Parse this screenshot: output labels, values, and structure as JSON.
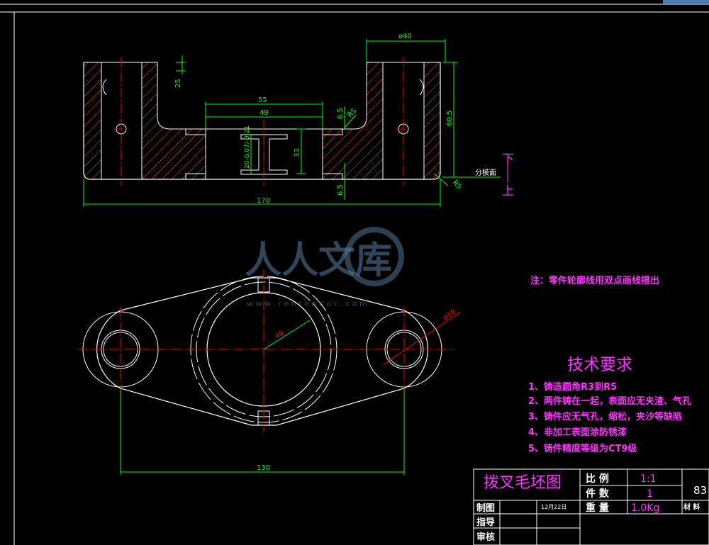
{
  "drawing": {
    "top_view": {
      "dims": {
        "phi40": "ø40",
        "d25": "25",
        "d55": "55",
        "d49": "49",
        "d65a": "6.5",
        "r5a": "R5",
        "d605": "60.5",
        "d33": "33",
        "tol": "20-0.07/-0.21",
        "d65b": "6.5",
        "r5b": "R5",
        "d170": "170"
      },
      "parting_label": "分模面",
      "down_label": "下",
      "up_label": "上"
    },
    "plan_view": {
      "dims": {
        "d49": "49",
        "phi16": "ø16",
        "d130": "130"
      }
    },
    "note": "注：零件轮廓线用双点画线描出",
    "tech": {
      "title": "技术要求",
      "items": [
        "1、铸造圆角R3到R5",
        "2、两件铸在一起，表面应无夹渣、气孔",
        "3、铸件应无气孔，缩松，夹沙等缺陷",
        "4、非加工表面涂防锈漆",
        "5、铸件精度等级为CT9级"
      ]
    },
    "title_block": {
      "name": "拨叉毛坯图",
      "scale_label": "比 例",
      "scale_value": "1:1",
      "qty_label": "件 数",
      "qty_value": "1",
      "weight_label": "重 量",
      "weight_value": "1.0Kg",
      "material_label": "材 料",
      "number": "83",
      "drawn_label": "制图",
      "date": "12月22日",
      "guide_label": "指导",
      "review_label": "审核"
    },
    "watermark": {
      "text": "人人文库",
      "url": "w w w . r e n r e n d o c . c o m"
    },
    "colors": {
      "outline": "#ffffff",
      "dimension": "#00ff00",
      "centerline": "#ff0000",
      "text": "#ff33ff",
      "hatch": "#ff6600"
    }
  }
}
